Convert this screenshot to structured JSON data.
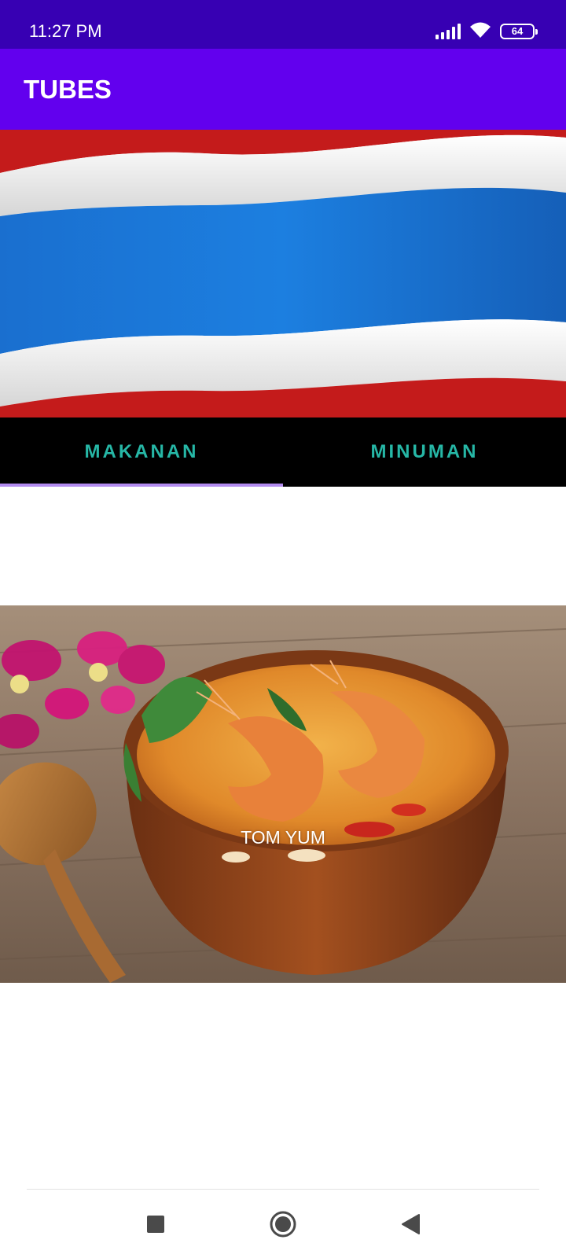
{
  "status_bar": {
    "time": "11:27 PM",
    "battery_level": "64",
    "icons": [
      "signal-icon",
      "wifi-icon",
      "battery-icon"
    ]
  },
  "app_bar": {
    "title": "TUBES",
    "color": "#6200ee"
  },
  "banner": {
    "image": "thailand-flag-image"
  },
  "tabs": [
    {
      "label": "MAKANAN",
      "selected": true
    },
    {
      "label": "MINUMAN",
      "selected": false
    }
  ],
  "content": {
    "items": [
      {
        "name": "TOM YUM",
        "image": "tom-yum-soup-image"
      }
    ]
  },
  "navigation_bar": {
    "buttons": [
      "recents-square-icon",
      "home-circle-icon",
      "back-triangle-icon"
    ]
  },
  "colors": {
    "status_bar": "#3700b3",
    "app_bar": "#6200ee",
    "tab_bar_bg": "#000000",
    "tab_text": "#26b7a6",
    "tab_indicator": "#b38cf0"
  }
}
